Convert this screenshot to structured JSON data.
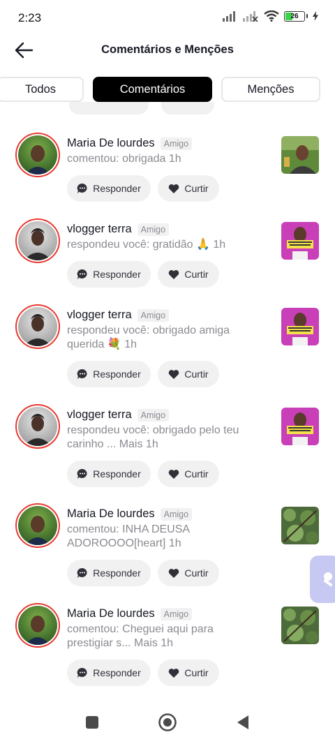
{
  "status": {
    "time": "2:23",
    "battery": "26"
  },
  "header": {
    "title": "Comentários e Menções",
    "back_icon": "arrow-left-icon"
  },
  "tabs": [
    {
      "label": "Todos",
      "active": false
    },
    {
      "label": "Comentários",
      "active": true
    },
    {
      "label": "Menções",
      "active": false
    }
  ],
  "comments": [
    {
      "name": "Maria De lourdes",
      "badge": "Amigo",
      "line1": "comentou: obrigada  1h",
      "line2": "",
      "reply": "Responder",
      "like": "Curtir",
      "thumb": "nature"
    },
    {
      "name": "vlogger terra",
      "badge": "Amigo",
      "line1": "respondeu você: gratidão 🙏  1h",
      "line2": "",
      "reply": "Responder",
      "like": "Curtir",
      "thumb": "pink"
    },
    {
      "name": "vlogger terra",
      "badge": "Amigo",
      "line1": "respondeu você: obrigado amiga",
      "line2": "querida 💐  1h",
      "reply": "Responder",
      "like": "Curtir",
      "thumb": "pink"
    },
    {
      "name": "vlogger terra",
      "badge": "Amigo",
      "line1": "respondeu você: obrigado pelo teu",
      "line2": "carinho ... Mais  1h",
      "reply": "Responder",
      "like": "Curtir",
      "thumb": "pink"
    },
    {
      "name": "Maria De lourdes",
      "badge": "Amigo",
      "line1": "comentou: INHA DEUSA",
      "line2": "ADOROOOO[heart]  1h",
      "reply": "Responder",
      "like": "Curtir",
      "thumb": "leaves"
    },
    {
      "name": "Maria De lourdes",
      "badge": "Amigo",
      "line1": "comentou: Cheguei aqui para",
      "line2": "prestigiar s... Mais  1h",
      "reply": "Responder",
      "like": "Curtir",
      "thumb": "leaves"
    }
  ],
  "nav": {
    "items": [
      "recent-apps-icon",
      "home-icon",
      "back-icon"
    ]
  }
}
